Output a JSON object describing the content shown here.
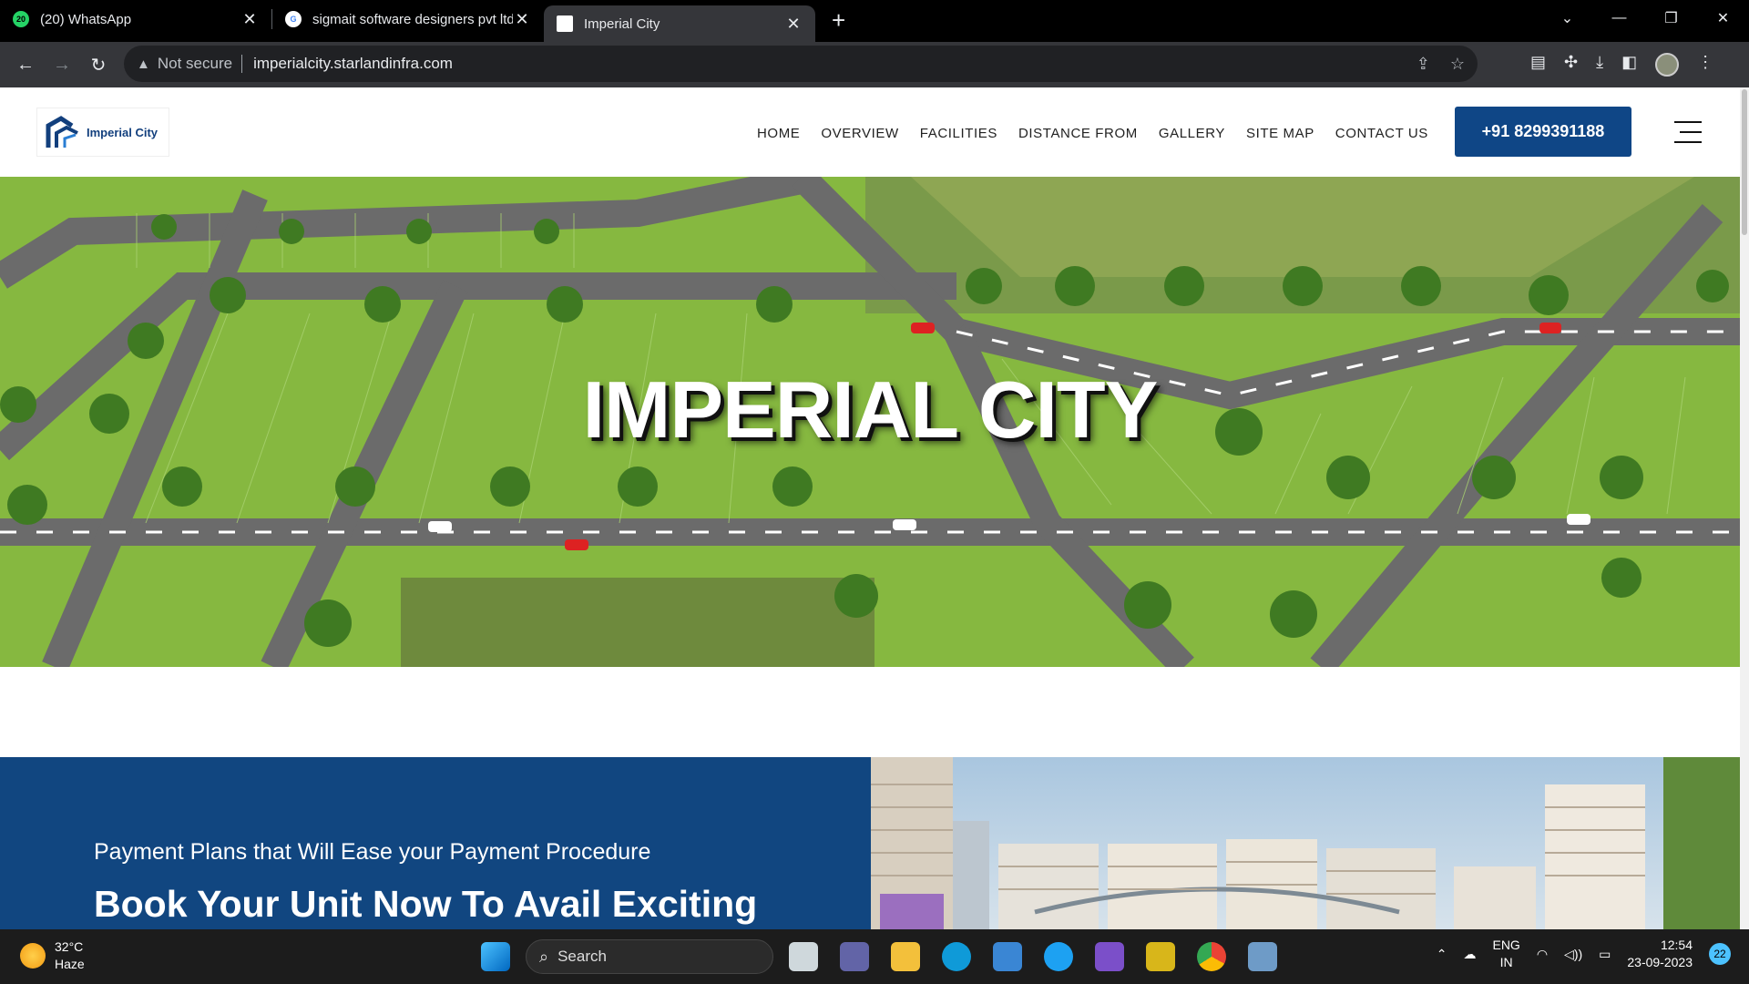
{
  "browser": {
    "tabs": [
      {
        "title": "(20) WhatsApp",
        "badge": "20",
        "active": false
      },
      {
        "title": "sigmait software designers pvt ltd",
        "badge": "G",
        "active": false
      },
      {
        "title": "Imperial City",
        "badge": "",
        "active": true
      }
    ],
    "security_label": "Not secure",
    "url": "imperialcity.starlandinfra.com"
  },
  "site": {
    "logo_text": "Imperial City",
    "nav": [
      "HOME",
      "OVERVIEW",
      "FACILITIES",
      "DISTANCE FROM",
      "GALLERY",
      "SITE MAP",
      "CONTACT US"
    ],
    "phone": "+91 8299391188",
    "hero_title": "IMPERIAL CITY",
    "promo_sub": "Payment Plans that Will Ease your Payment Procedure",
    "promo_heading": "Book Your Unit Now To Avail Exciting"
  },
  "taskbar": {
    "temp": "32°C",
    "condition": "Haze",
    "search_placeholder": "Search",
    "lang_top": "ENG",
    "lang_bottom": "IN",
    "time": "12:54",
    "date": "23-09-2023",
    "notifications": "22"
  },
  "colors": {
    "brand_blue": "#0f4686",
    "grass": "#7fb63a",
    "road": "#6e6e6e"
  }
}
